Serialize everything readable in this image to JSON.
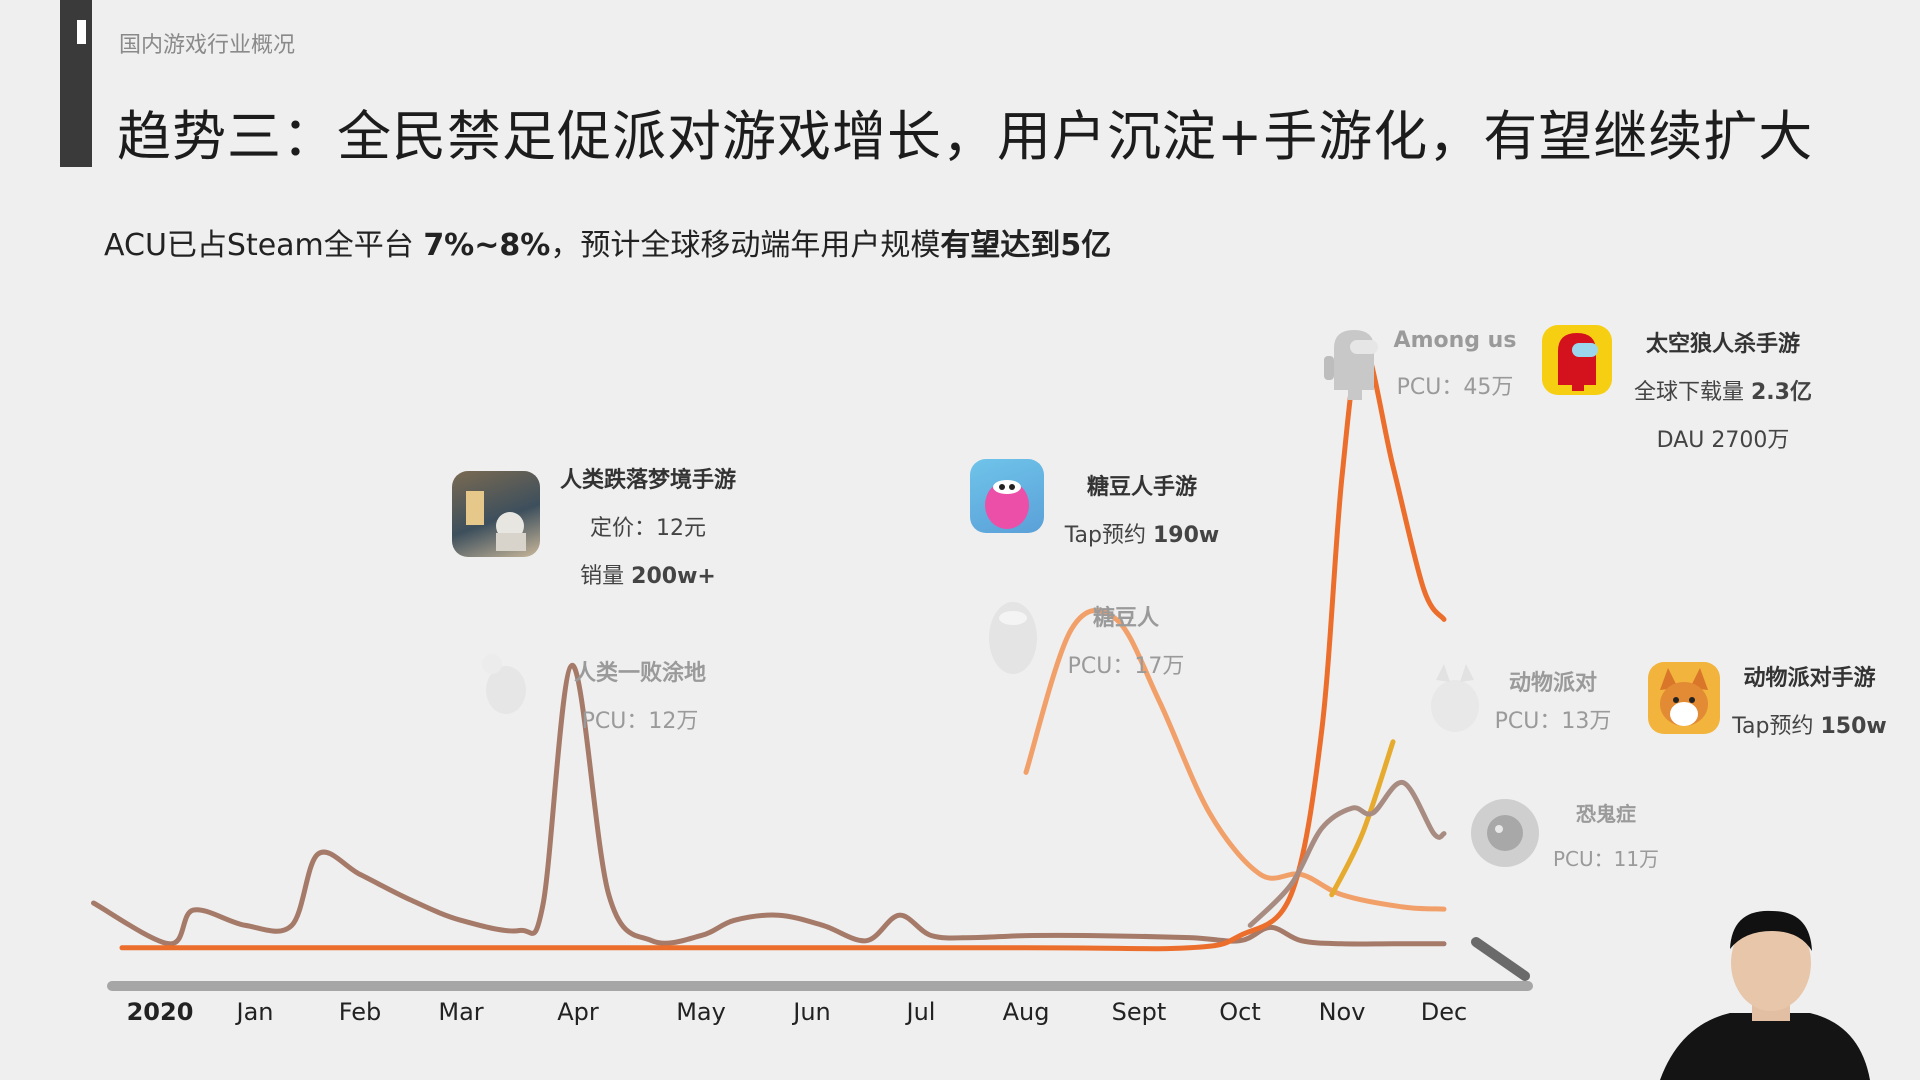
{
  "header": {
    "section": "国内游戏行业概况",
    "title": "趋势三：全民禁足促派对游戏增长，用户沉淀+手游化，有望继续扩大",
    "subtitle_prefix": "ACU已占Steam全平台 ",
    "subtitle_pct": "7%~8%",
    "subtitle_mid": "，预计全球移动端年用户规模",
    "subtitle_bold": "有望达到5亿"
  },
  "annotations": {
    "human_fall_mobile": {
      "name": "人类跌落梦境手游",
      "price": "定价：12元",
      "sales_prefix": "销量 ",
      "sales_value": "200w+"
    },
    "human_fall_pc": {
      "name": "人类一败涂地",
      "pcu": "PCU：12万"
    },
    "fall_guys_mobile": {
      "name": "糖豆人手游",
      "tap_prefix": "Tap预约 ",
      "tap_value": "190w"
    },
    "fall_guys_pc": {
      "name": "糖豆人",
      "pcu": "PCU：17万"
    },
    "among_us": {
      "name": "Among us",
      "pcu": "PCU：45万"
    },
    "among_us_mobile": {
      "name": "太空狼人杀手游",
      "downloads_prefix": "全球下载量 ",
      "downloads_value": "2.3亿",
      "dau": "DAU 2700万"
    },
    "party_animals": {
      "name": "动物派对",
      "pcu": "PCU：13万"
    },
    "party_animals_mobile": {
      "name": "动物派对手游",
      "tap_prefix": "Tap预约 ",
      "tap_value": "150w"
    },
    "phasmophobia": {
      "name": "恐鬼症",
      "pcu": "PCU：11万"
    }
  },
  "chart_data": {
    "type": "line",
    "title": "",
    "x": [
      "2020",
      "Jan",
      "Feb",
      "Mar",
      "Apr",
      "May",
      "Jun",
      "Jul",
      "Aug",
      "Sept",
      "Oct",
      "Nov",
      "Dec"
    ],
    "xlabel": "",
    "ylabel": "",
    "grid": false,
    "legend": "none",
    "colors": {
      "human_fall_flat": "#a57a69",
      "fall_guys": "#f2a06a",
      "among_us": "#ec6e2c",
      "party_animals": "#e6ab2e",
      "phasmophobia": "#a88c82",
      "axis": "#999999"
    },
    "series": [
      {
        "key": "human_fall_flat",
        "points": [
          [
            -0.7,
            5.2
          ],
          [
            0.1,
            1.2
          ],
          [
            0.35,
            4.5
          ],
          [
            0.9,
            3.0
          ],
          [
            1.35,
            3.0
          ],
          [
            1.6,
            10.0
          ],
          [
            2.0,
            8.0
          ],
          [
            2.5,
            5.5
          ],
          [
            3.0,
            3.5
          ],
          [
            3.5,
            2.5
          ],
          [
            3.7,
            5.0
          ],
          [
            3.95,
            28.5
          ],
          [
            4.25,
            6.0
          ],
          [
            4.6,
            1.5
          ],
          [
            5.0,
            2.0
          ],
          [
            5.3,
            3.5
          ],
          [
            5.7,
            4.0
          ],
          [
            6.1,
            3.0
          ],
          [
            6.5,
            1.5
          ],
          [
            6.8,
            4.0
          ],
          [
            7.1,
            2.0
          ],
          [
            7.5,
            1.8
          ],
          [
            8.0,
            2.0
          ],
          [
            8.6,
            2.0
          ],
          [
            9.5,
            1.8
          ],
          [
            10.0,
            1.5
          ],
          [
            10.3,
            2.8
          ],
          [
            10.6,
            1.5
          ],
          [
            11.0,
            1.2
          ],
          [
            11.5,
            1.2
          ],
          [
            12.0,
            1.2
          ]
        ]
      },
      {
        "key": "fall_guys",
        "points": [
          [
            8.0,
            18.0
          ],
          [
            8.4,
            32.0
          ],
          [
            8.8,
            33.0
          ],
          [
            9.2,
            25.0
          ],
          [
            9.7,
            14.0
          ],
          [
            10.2,
            8.0
          ],
          [
            10.6,
            8.0
          ],
          [
            11.0,
            6.0
          ],
          [
            11.6,
            4.8
          ],
          [
            12.0,
            4.6
          ]
        ]
      },
      {
        "key": "among_us",
        "points": [
          [
            -0.4,
            0.8
          ],
          [
            4.0,
            0.8
          ],
          [
            8.0,
            0.8
          ],
          [
            9.5,
            0.8
          ],
          [
            10.0,
            2.0
          ],
          [
            10.5,
            6.0
          ],
          [
            10.8,
            22.0
          ],
          [
            11.0,
            47.0
          ],
          [
            11.2,
            60.0
          ],
          [
            11.5,
            48.0
          ],
          [
            11.8,
            36.0
          ],
          [
            12.0,
            33.0
          ]
        ]
      },
      {
        "key": "party_animals",
        "points": [
          [
            10.9,
            6.0
          ],
          [
            11.2,
            12.0
          ],
          [
            11.5,
            21.0
          ]
        ]
      },
      {
        "key": "phasmophobia",
        "points": [
          [
            10.1,
            3.0
          ],
          [
            10.5,
            7.0
          ],
          [
            10.8,
            12.5
          ],
          [
            11.1,
            14.5
          ],
          [
            11.3,
            14.0
          ],
          [
            11.6,
            17.0
          ],
          [
            11.9,
            12.0
          ],
          [
            12.0,
            12.0
          ]
        ]
      }
    ]
  }
}
